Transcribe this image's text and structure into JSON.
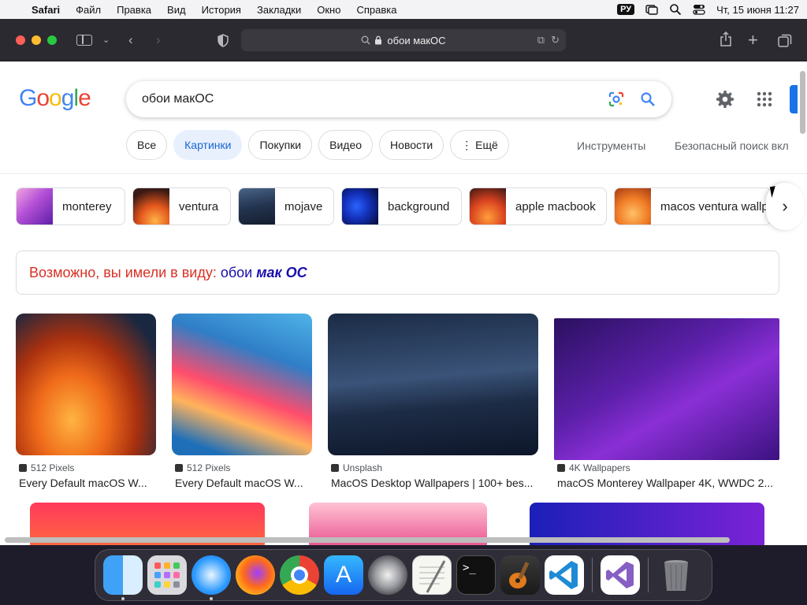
{
  "menubar": {
    "app": "Safari",
    "items": [
      "Файл",
      "Правка",
      "Вид",
      "История",
      "Закладки",
      "Окно",
      "Справка"
    ],
    "input_source": "РУ",
    "datetime": "Чт, 15 июня 11:27"
  },
  "browser": {
    "address": "обои макОС"
  },
  "search": {
    "query": "обои макОС",
    "tabs": [
      {
        "label": "Все"
      },
      {
        "label": "Картинки",
        "active": true
      },
      {
        "label": "Покупки"
      },
      {
        "label": "Видео"
      },
      {
        "label": "Новости"
      },
      {
        "label": "⋮ Ещё"
      }
    ],
    "tools_label": "Инструменты",
    "safesearch_label": "Безопасный поиск вкл"
  },
  "suggestions": [
    {
      "label": "monterey"
    },
    {
      "label": "ventura"
    },
    {
      "label": "mojave"
    },
    {
      "label": "background"
    },
    {
      "label": "apple macbook"
    },
    {
      "label": "macos ventura wallpa"
    }
  ],
  "did_you_mean": {
    "prefix": "Возможно, вы имели в виду:",
    "plain": "обои",
    "bold": "мак ОС"
  },
  "results": [
    {
      "source": "512 Pixels",
      "title": "Every Default macOS W..."
    },
    {
      "source": "512 Pixels",
      "title": "Every Default macOS W..."
    },
    {
      "source": "Unsplash",
      "title": "MacOS Desktop Wallpapers | 100+ bes..."
    },
    {
      "source": "4K Wallpapers",
      "title": "macOS Monterey Wallpaper 4K, WWDC 2..."
    }
  ],
  "dock": [
    "finder",
    "launchpad",
    "safari",
    "firefox",
    "chrome",
    "app-store",
    "system-settings",
    "textedit",
    "terminal",
    "garageband",
    "vscode",
    "visual-studio",
    "trash"
  ]
}
